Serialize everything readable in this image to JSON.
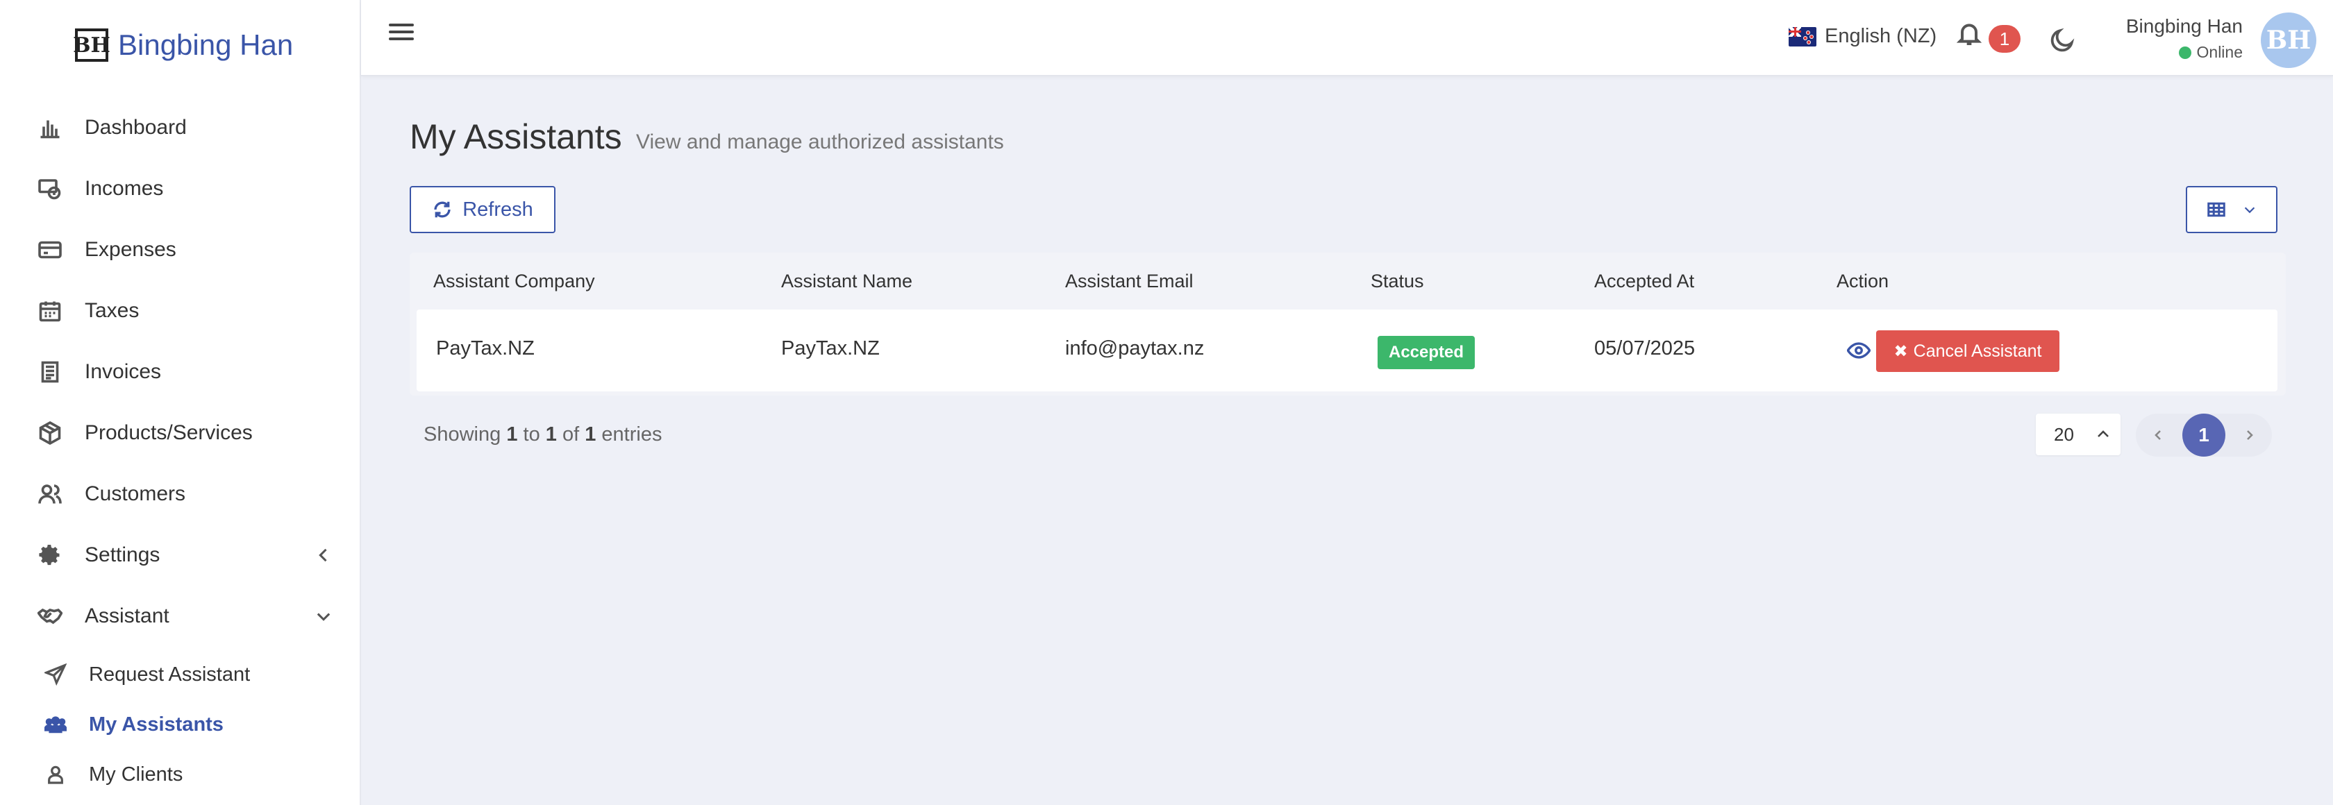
{
  "brand": {
    "logo_text": "BH",
    "name": "Bingbing Han"
  },
  "sidebar": {
    "items": [
      {
        "label": "Dashboard",
        "icon": "bar-chart-icon"
      },
      {
        "label": "Incomes",
        "icon": "income-icon"
      },
      {
        "label": "Expenses",
        "icon": "credit-card-icon"
      },
      {
        "label": "Taxes",
        "icon": "calendar-icon"
      },
      {
        "label": "Invoices",
        "icon": "invoice-icon"
      },
      {
        "label": "Products/Services",
        "icon": "box-icon"
      },
      {
        "label": "Customers",
        "icon": "users-icon"
      },
      {
        "label": "Settings",
        "icon": "gear-icon"
      },
      {
        "label": "Assistant",
        "icon": "handshake-icon"
      }
    ],
    "assistant_sub": [
      {
        "label": "Request Assistant",
        "icon": "paper-plane-icon"
      },
      {
        "label": "My Assistants",
        "icon": "user-group-icon",
        "active": true
      },
      {
        "label": "My Clients",
        "icon": "user-icon"
      }
    ]
  },
  "topbar": {
    "language": "English (NZ)",
    "notification_count": "1",
    "user_name": "Bingbing Han",
    "user_status": "Online",
    "avatar_initials": "BH"
  },
  "main": {
    "title": "My Assistants",
    "subtitle": "View and manage authorized assistants",
    "refresh_label": "Refresh",
    "table": {
      "headers": [
        "Assistant Company",
        "Assistant Name",
        "Assistant Email",
        "Status",
        "Accepted At",
        "Action"
      ],
      "rows": [
        {
          "company": "PayTax.NZ",
          "name": "PayTax.NZ",
          "email": "info@paytax.nz",
          "status": "Accepted",
          "accepted_at": "05/07/2025",
          "cancel_label": "Cancel Assistant"
        }
      ]
    },
    "footer": {
      "showing_prefix": "Showing",
      "from": "1",
      "to_word": "to",
      "to": "1",
      "of_word": "of",
      "total": "1",
      "entries_word": "entries",
      "page_size": "20",
      "current_page": "1"
    }
  },
  "colors": {
    "accent": "#3a55a8",
    "success": "#3cb76b",
    "danger": "#e0554f",
    "pager_active": "#5866b4"
  }
}
